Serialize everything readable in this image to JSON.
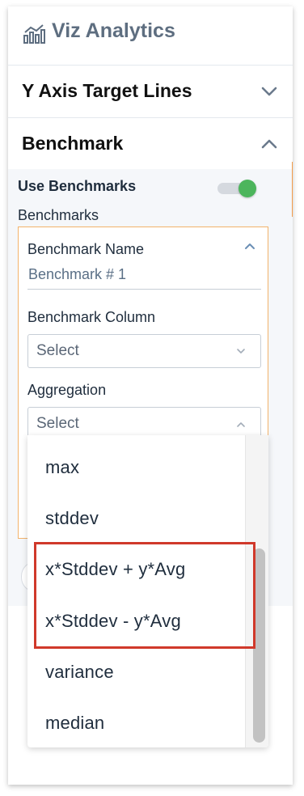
{
  "app": {
    "title": "Viz Analytics",
    "logo_icon": "chart-bars-icon"
  },
  "sections": {
    "y_axis_target_lines": {
      "label": "Y Axis Target Lines",
      "expanded": false
    },
    "benchmark": {
      "label": "Benchmark",
      "expanded": true
    }
  },
  "benchmark_panel": {
    "use_benchmarks_label": "Use Benchmarks",
    "use_benchmarks_on": true,
    "benchmarks_label": "Benchmarks",
    "card": {
      "name_label": "Benchmark Name",
      "name_value": "Benchmark # 1",
      "column_label": "Benchmark Column",
      "column_value": "Select",
      "aggregation_label": "Aggregation",
      "aggregation_value": "Select"
    }
  },
  "aggregation_dropdown": {
    "options": [
      "max",
      "stddev",
      "x*Stddev + y*Avg",
      "x*Stddev - y*Avg",
      "variance",
      "median"
    ],
    "highlighted": [
      "x*Stddev + y*Avg",
      "x*Stddev - y*Avg"
    ]
  },
  "colors": {
    "toggle_on": "#4cb55c",
    "card_border": "#f3b36b",
    "highlight_border": "#d0392b",
    "accent_scroll": "#f39c4a"
  }
}
